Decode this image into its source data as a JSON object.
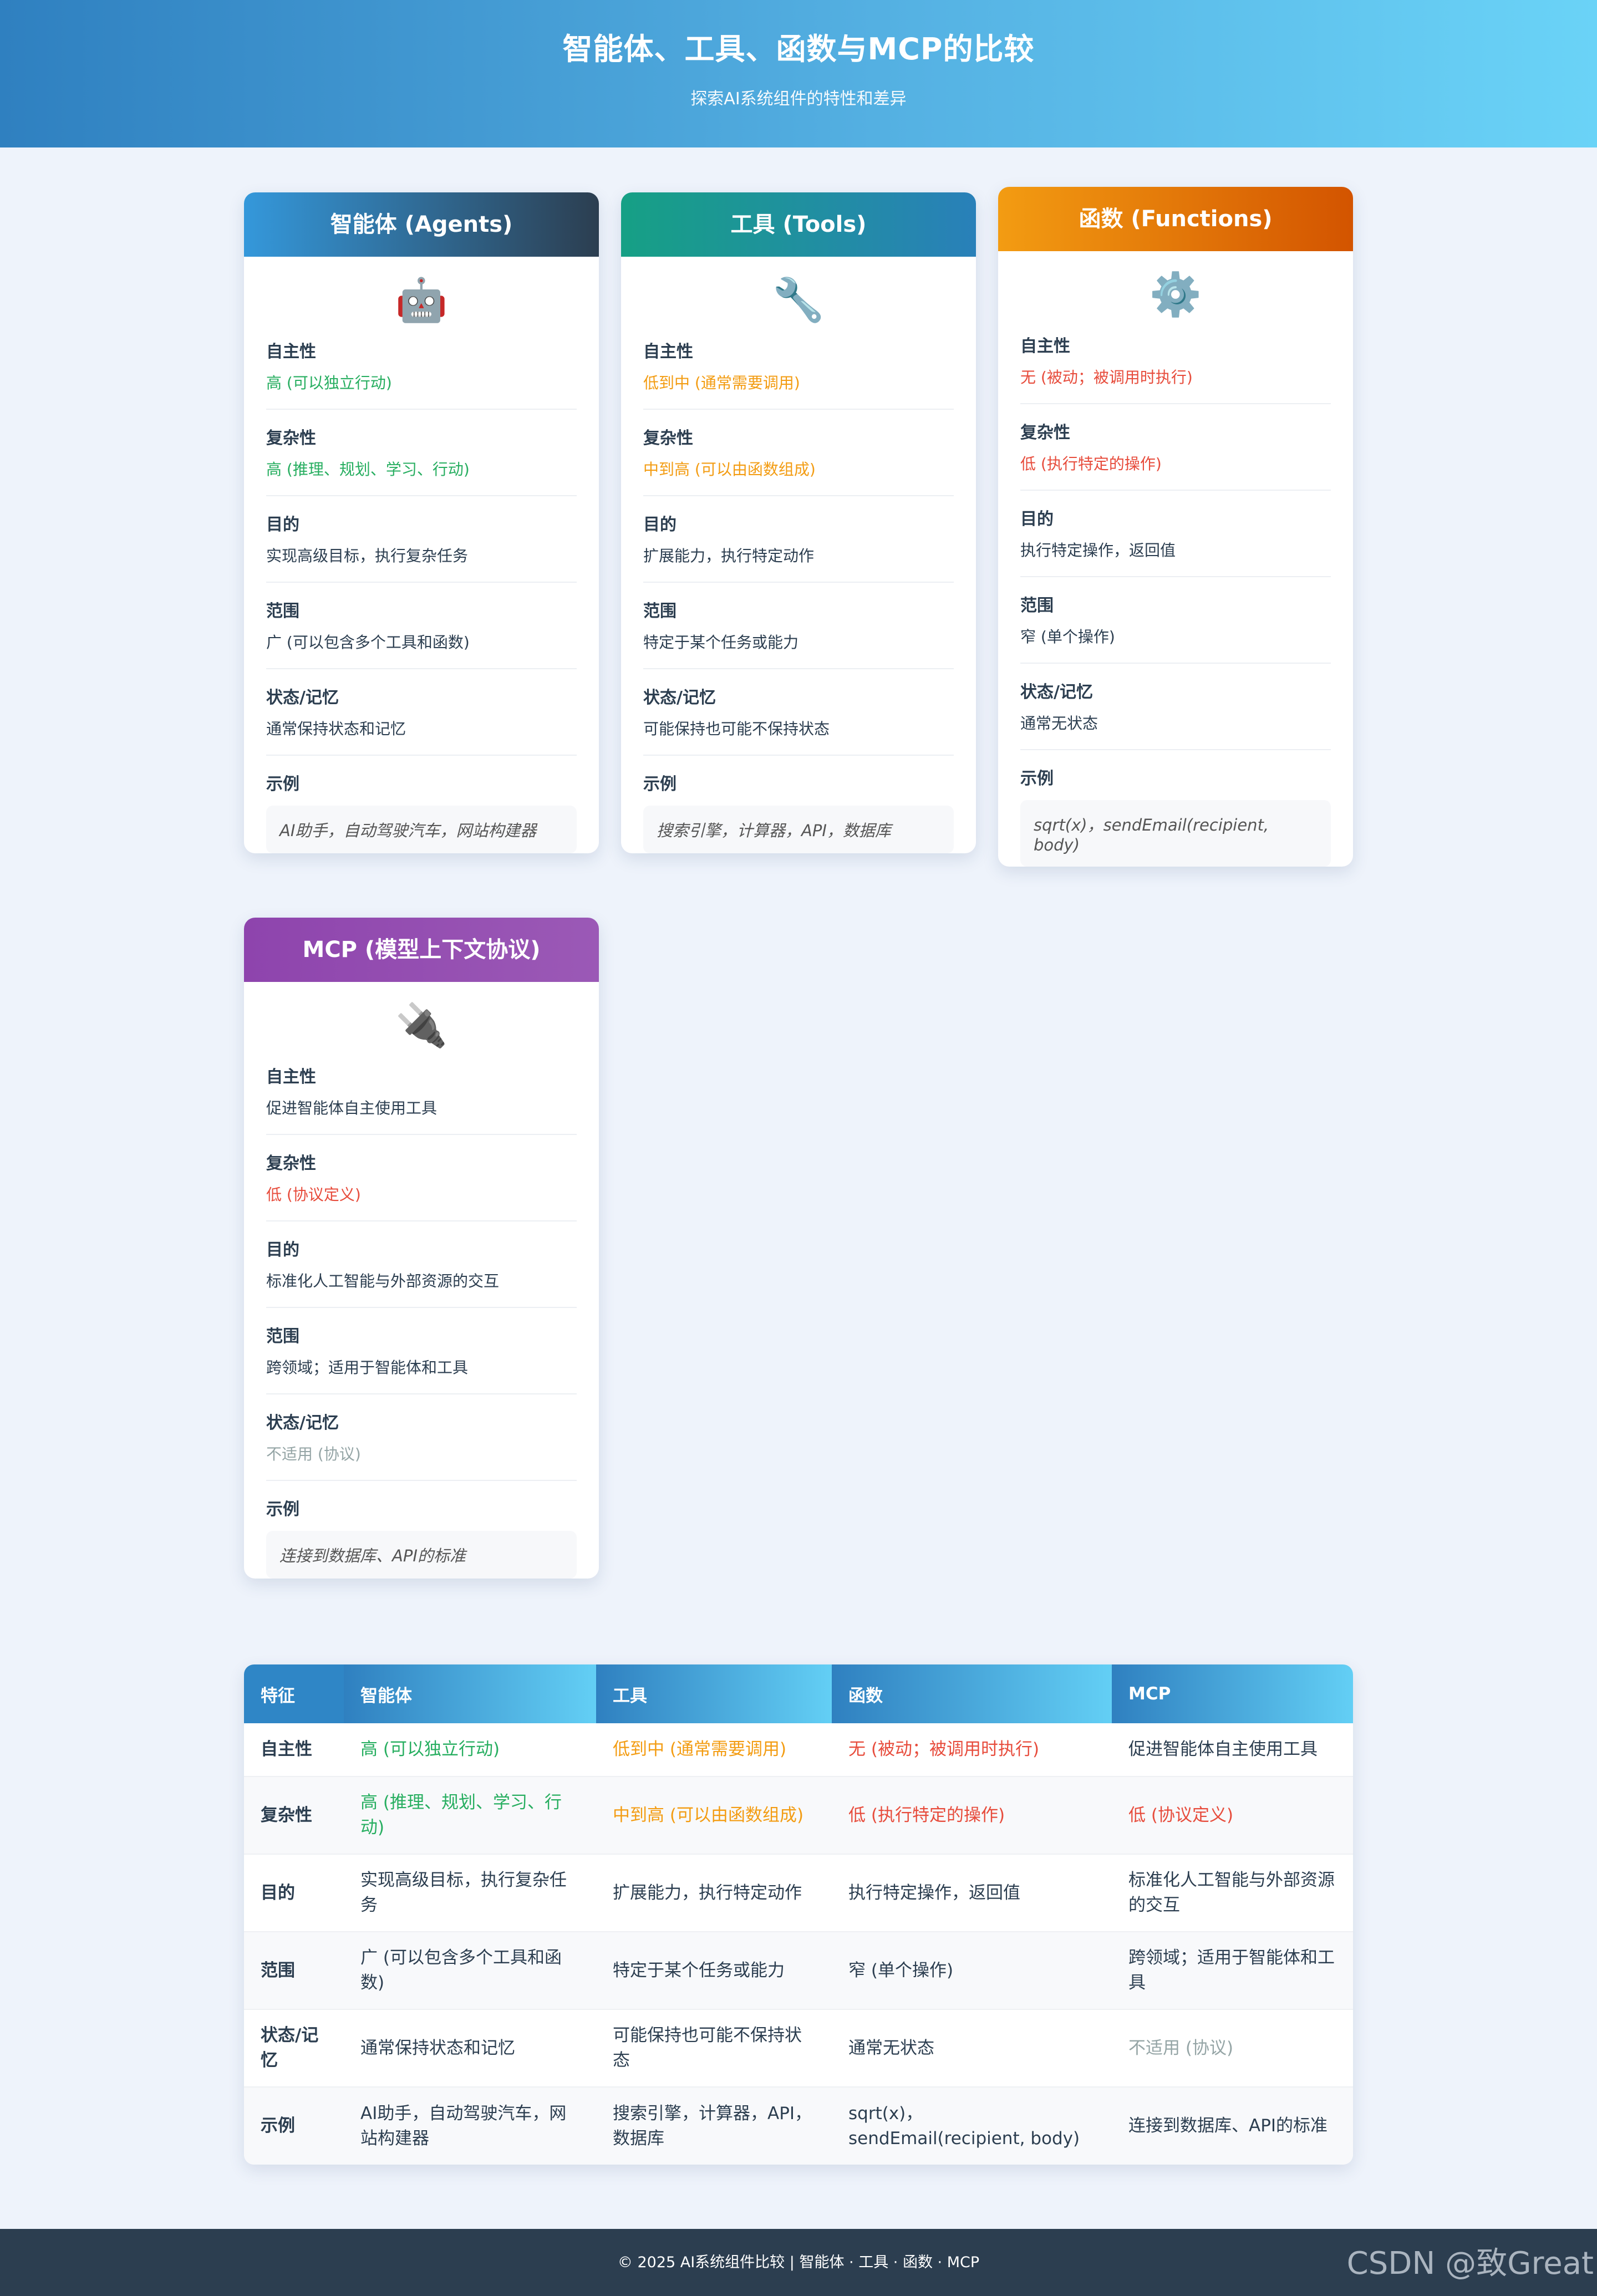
{
  "header": {
    "title": "智能体、工具、函数与MCP的比较",
    "subtitle": "探索AI系统组件的特性和差异"
  },
  "labels": {
    "autonomy": "自主性",
    "complexity": "复杂性",
    "purpose": "目的",
    "scope": "范围",
    "state": "状态/记忆",
    "example": "示例"
  },
  "cards": [
    {
      "title": "智能体 (Agents)",
      "icon": "robot-icon",
      "icon_glyph": "🤖",
      "gradient": [
        "#3498db",
        "#2c3e50"
      ],
      "autonomy": "高 (可以独立行动)",
      "complexity": "高 (推理、规划、学习、行动)",
      "purpose": "实现高级目标，执行复杂任务",
      "scope": "广 (可以包含多个工具和函数)",
      "state": "通常保持状态和记忆",
      "example": "AI助手，自动驾驶汽车，网站构建器"
    },
    {
      "title": "工具 (Tools)",
      "icon": "wrench-icon",
      "icon_glyph": "🔧",
      "gradient": [
        "#16a085",
        "#2980b9"
      ],
      "autonomy": "低到中 (通常需要调用)",
      "complexity": "中到高 (可以由函数组成)",
      "purpose": "扩展能力，执行特定动作",
      "scope": "特定于某个任务或能力",
      "state": "可能保持也可能不保持状态",
      "example": "搜索引擎，计算器，API，数据库"
    },
    {
      "title": "函数 (Functions)",
      "icon": "gear-icon",
      "icon_glyph": "⚙️",
      "gradient": [
        "#f39c12",
        "#d35400"
      ],
      "autonomy": "无 (被动；被调用时执行)",
      "complexity": "低 (执行特定的操作)",
      "purpose": "执行特定操作，返回值",
      "scope": "窄 (单个操作)",
      "state": "通常无状态",
      "example": "sqrt(x)，sendEmail(recipient, body)"
    },
    {
      "title": "MCP (模型上下文协议)",
      "icon": "plug-icon",
      "icon_glyph": "🔌",
      "gradient": [
        "#8e44ad",
        "#9b59b6"
      ],
      "autonomy": "促进智能体自主使用工具",
      "complexity": "低 (协议定义)",
      "purpose": "标准化人工智能与外部资源的交互",
      "scope": "跨领域；适用于智能体和工具",
      "state": "不适用 (协议)",
      "example": "连接到数据库、API的标准"
    }
  ],
  "table": {
    "headers": [
      "特征",
      "智能体",
      "工具",
      "函数",
      "MCP"
    ],
    "rows": [
      {
        "feature": "自主性",
        "cells": [
          "高 (可以独立行动)",
          "低到中 (通常需要调用)",
          "无 (被动；被调用时执行)",
          "促进智能体自主使用工具"
        ]
      },
      {
        "feature": "复杂性",
        "cells": [
          "高 (推理、规划、学习、行动)",
          "中到高 (可以由函数组成)",
          "低 (执行特定的操作)",
          "低 (协议定义)"
        ]
      },
      {
        "feature": "目的",
        "cells": [
          "实现高级目标，执行复杂任务",
          "扩展能力，执行特定动作",
          "执行特定操作，返回值",
          "标准化人工智能与外部资源的交互"
        ]
      },
      {
        "feature": "范围",
        "cells": [
          "广 (可以包含多个工具和函数)",
          "特定于某个任务或能力",
          "窄 (单个操作)",
          "跨领域；适用于智能体和工具"
        ]
      },
      {
        "feature": "状态/记忆",
        "cells": [
          "通常保持状态和记忆",
          "可能保持也可能不保持状态",
          "通常无状态",
          "不适用 (协议)"
        ]
      },
      {
        "feature": "示例",
        "cells": [
          "AI助手，自动驾驶汽车，网站构建器",
          "搜索引擎，计算器，API，数据库",
          "sqrt(x)，sendEmail(recipient, body)",
          "连接到数据库、API的标准"
        ]
      }
    ]
  },
  "colors": {
    "green": "#27ae60",
    "orange": "#f39c12",
    "red": "#e74c3c",
    "gray": "#95a5a6"
  },
  "footer": {
    "text": "© 2025 AI系统组件比较 | 智能体 · 工具 · 函数 · MCP"
  },
  "watermark": "CSDN @致Great"
}
